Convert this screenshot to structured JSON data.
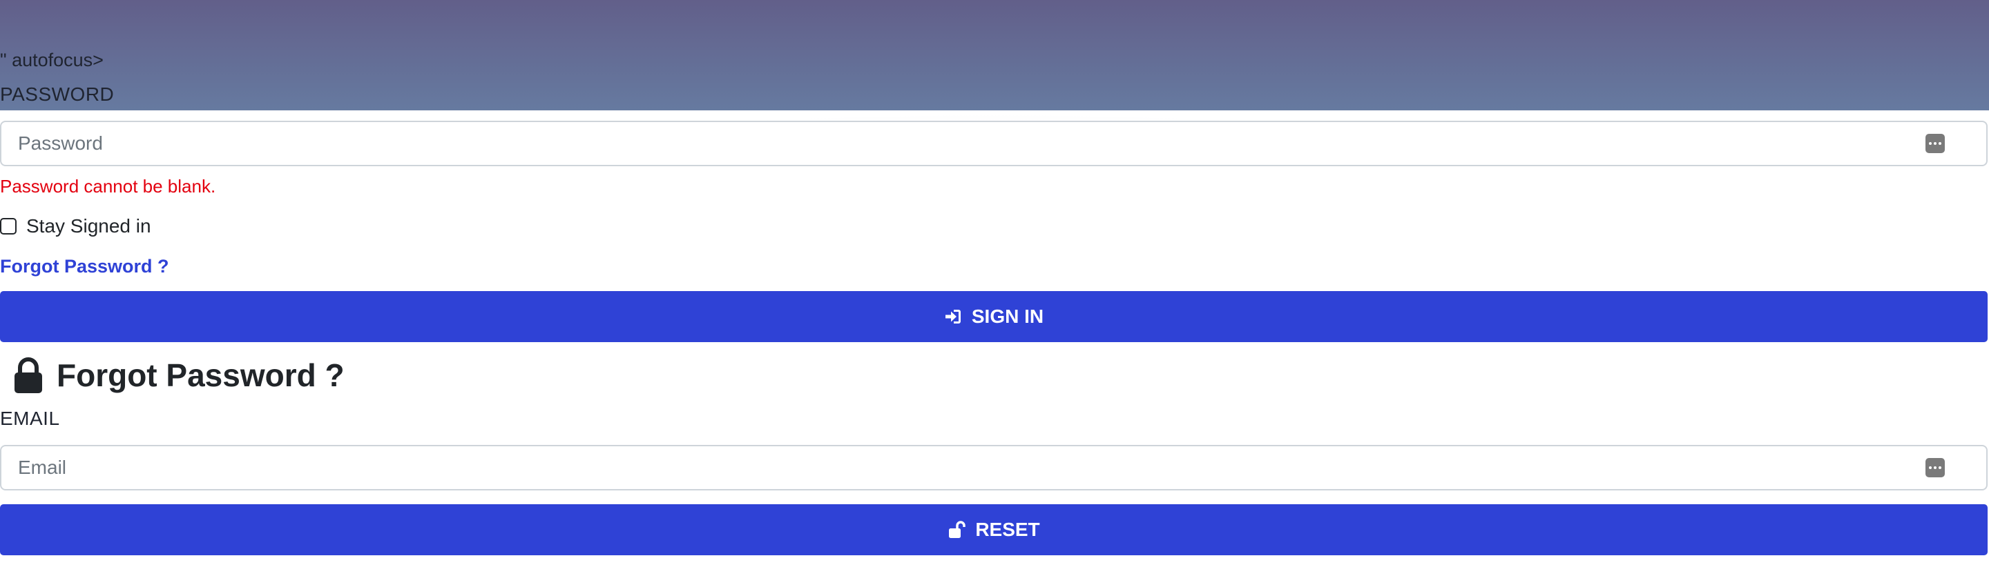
{
  "stray_markup_text": "\" autofocus>",
  "password_section": {
    "label": "PASSWORD",
    "placeholder": "Password",
    "value": "",
    "icon": "password-dots-icon",
    "error": "Password cannot be blank."
  },
  "stay_signed_in": {
    "label": "Stay Signed in",
    "checked": false
  },
  "forgot_password_link": "Forgot Password ?",
  "sign_in_button": {
    "label": "SIGN IN",
    "icon": "sign-in-icon"
  },
  "forgot_section": {
    "heading": "Forgot Password ?",
    "icon": "lock-icon",
    "email_label": "EMAIL",
    "email_placeholder": "Email",
    "email_value": "",
    "email_icon": "password-dots-icon"
  },
  "reset_button": {
    "label": "RESET",
    "icon": "unlock-icon"
  },
  "colors": {
    "primary": "#2f42d6",
    "error": "#e3000f",
    "header_band": "#647099"
  }
}
